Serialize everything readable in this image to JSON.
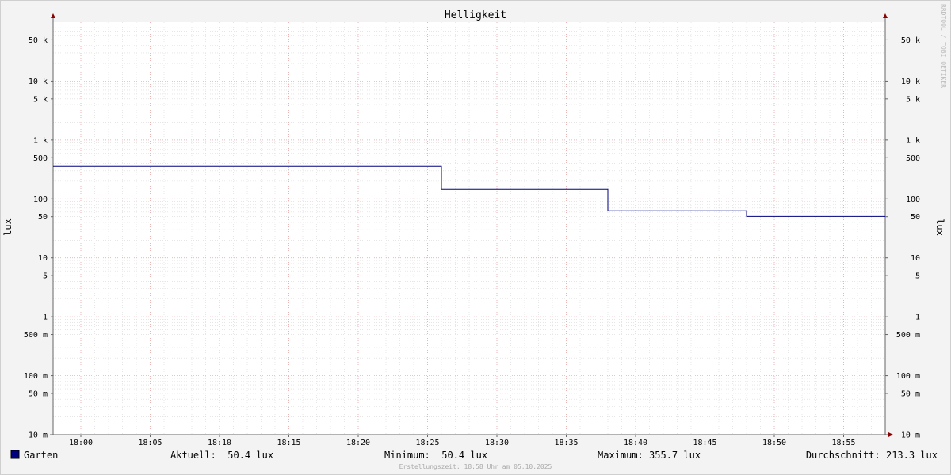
{
  "chart_data": {
    "type": "line",
    "title": "Helligkeit",
    "ylabel": "lux",
    "ylabel_right": "lux",
    "yscale": "log",
    "ylim": [
      0.01,
      100000
    ],
    "y_ticks": [
      {
        "value": 50000,
        "label": "50 k"
      },
      {
        "value": 10000,
        "label": "10 k"
      },
      {
        "value": 5000,
        "label": "5 k"
      },
      {
        "value": 1000,
        "label": "1 k"
      },
      {
        "value": 500,
        "label": "500"
      },
      {
        "value": 100,
        "label": "100"
      },
      {
        "value": 50,
        "label": "50"
      },
      {
        "value": 10,
        "label": "10"
      },
      {
        "value": 5,
        "label": "5"
      },
      {
        "value": 1,
        "label": "1"
      },
      {
        "value": 0.5,
        "label": "500 m"
      },
      {
        "value": 0.1,
        "label": "100 m"
      },
      {
        "value": 0.05,
        "label": "50 m"
      },
      {
        "value": 0.01,
        "label": "10 m"
      }
    ],
    "xlim": [
      "17:58",
      "18:58"
    ],
    "x_ticks": [
      "18:00",
      "18:05",
      "18:10",
      "18:15",
      "18:20",
      "18:25",
      "18:30",
      "18:35",
      "18:40",
      "18:45",
      "18:50",
      "18:55"
    ],
    "grid": true,
    "series": [
      {
        "name": "Garten",
        "color": "#000080",
        "step": true,
        "points": [
          {
            "x": "17:58",
            "y": 355.7
          },
          {
            "x": "18:26",
            "y": 145
          },
          {
            "x": "18:38",
            "y": 63
          },
          {
            "x": "18:48",
            "y": 50.4
          },
          {
            "x": "18:58",
            "y": 50.4
          }
        ]
      }
    ]
  },
  "legend": {
    "series_name": "Garten",
    "series_color": "#000080",
    "current": "Aktuell:  50.4 lux",
    "minimum": "Minimum:  50.4 lux",
    "maximum": "Maximum: 355.7 lux",
    "average": "Durchschnitt: 213.3 lux"
  },
  "footer": "Erstellungszeit: 18:58 Uhr am 05.10.2025",
  "watermark": "RRDTOOL / TOBI OETIKER",
  "colors": {
    "line": "#000080",
    "minor_grid": "#d8d8d8",
    "major_grid": "#e8a0a0",
    "axis": "#666666",
    "arrow": "#8b0000"
  }
}
